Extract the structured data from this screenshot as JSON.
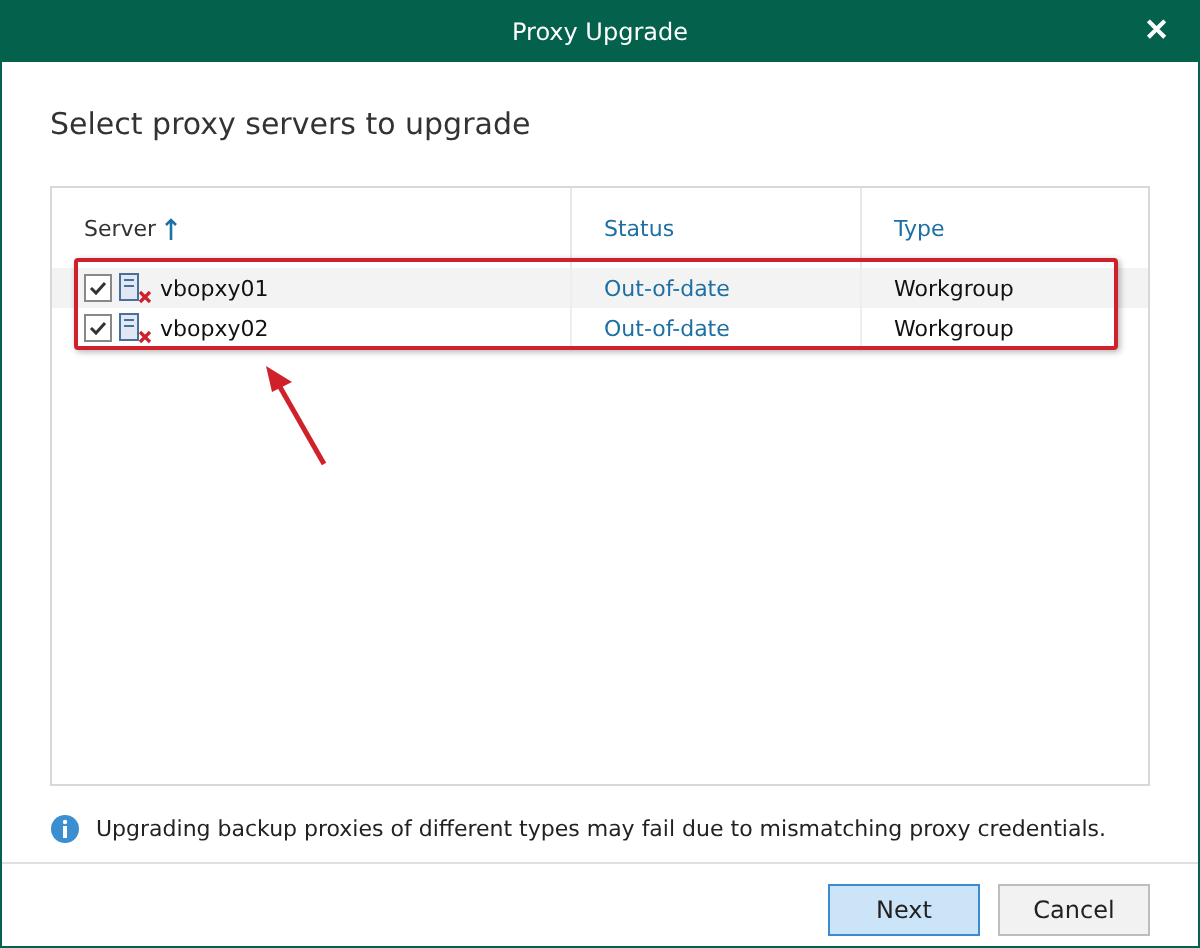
{
  "window": {
    "title": "Proxy Upgrade",
    "close": "✕"
  },
  "heading": "Select proxy servers to upgrade",
  "table": {
    "columns": [
      {
        "label": "Server",
        "sorted": true
      },
      {
        "label": "Status",
        "sorted": false
      },
      {
        "label": "Type",
        "sorted": false
      }
    ],
    "rows": [
      {
        "checked": true,
        "server": "vbopxy01",
        "status": "Out-of-date",
        "type": "Workgroup"
      },
      {
        "checked": true,
        "server": "vbopxy02",
        "status": "Out-of-date",
        "type": "Workgroup"
      }
    ]
  },
  "info": "Upgrading backup proxies of different types may fail due to mismatching proxy credentials.",
  "buttons": [
    {
      "label": "Next",
      "primary": true
    },
    {
      "label": "Cancel",
      "primary": false
    }
  ]
}
